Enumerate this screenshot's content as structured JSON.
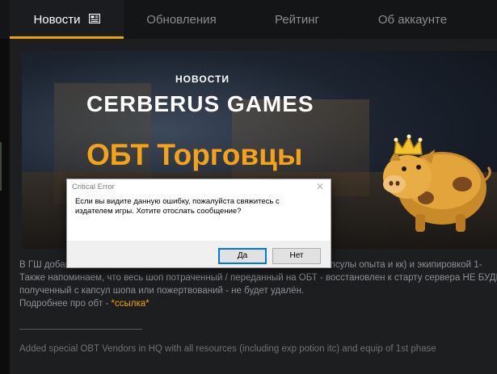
{
  "tabs": [
    {
      "label": "Новости",
      "icon": "newspaper-icon",
      "active": true
    },
    {
      "label": "Обновления"
    },
    {
      "label": "Рейтинг"
    },
    {
      "label": "Об аккаунте"
    }
  ],
  "banner": {
    "kicker": "НОВОСТИ",
    "brand": "CERBERUS GAMES",
    "headline": "ОБТ Торговцы"
  },
  "news": {
    "line1_start": "В ГШ добав",
    "line1_end": "ная капсулы опыта и кк) и экипировкой 1-",
    "line2_start": "Также напоминаем, что весь шоп потраченный / переданный на ОБТ - восстановлен к старту сервера НЕ БУДЕТ!",
    "line3": "полученный с капсул шопа или пожертвований - не будет удалён.",
    "line4_prefix": "Подробнее про обт - ",
    "line4_link": "*ссылка*",
    "english_line": "Added special OBT Vendors in HQ with all resources (including exp potion itc) and equip of 1st phase"
  },
  "dialog": {
    "title": "Critical Error",
    "message": "Если вы видите данную ошибку, пожалуйста свяжитесь с издателем игры. Хотите отослать сообщение?",
    "yes": "Да",
    "no": "Нет"
  },
  "colors": {
    "accent": "#f2a300",
    "background": "#1d1e20"
  }
}
